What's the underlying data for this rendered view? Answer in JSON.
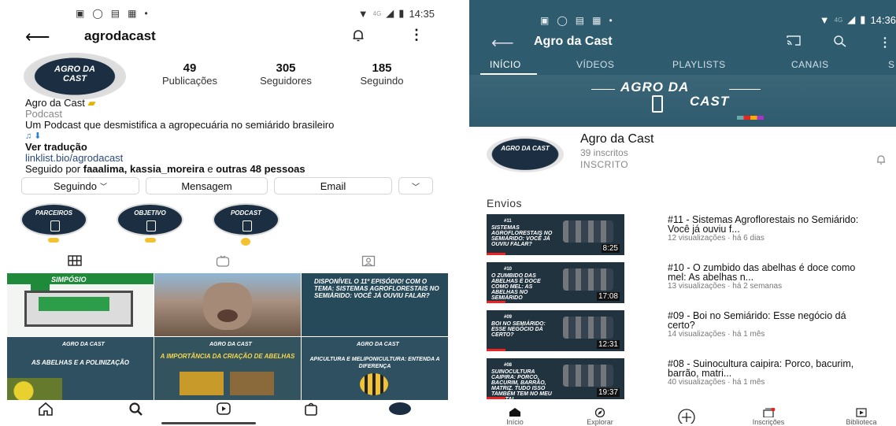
{
  "status_left": {
    "time": "14:35",
    "net": "4G"
  },
  "status_right": {
    "time": "14:36",
    "net": "4G"
  },
  "instagram": {
    "username": "agrodacast",
    "avatar_text": "AGRO DA CAST",
    "stats": [
      {
        "value": "49",
        "label": "Publicações"
      },
      {
        "value": "305",
        "label": "Seguidores"
      },
      {
        "value": "185",
        "label": "Seguindo"
      }
    ],
    "display_name": "Agro da Cast",
    "category": "Podcast",
    "bio": "Um Podcast que desmistifica a agropecuária no semiárido brasileiro",
    "translate": "Ver tradução",
    "link": "linklist.bio/agrodacast",
    "followed_by_prefix": "Seguido por",
    "followed_by_names": "faaalima, kassia_moreira",
    "followed_by_mid": "e",
    "followed_by_rest": "outras 48 pessoas",
    "buttons": {
      "following": "Seguindo",
      "message": "Mensagem",
      "email": "Email"
    },
    "highlights": [
      "PARCEIROS",
      "OBJETIVO",
      "PODCAST"
    ],
    "grid": [
      {
        "caption": "SIMPÓSIO"
      },
      {
        "caption": ""
      },
      {
        "caption": "DISPONÍVEL O 11º EPISÓDIO! COM O TEMA: SISTEMAS AGROFLORESTAIS NO SEMIÁRIDO: VOCÊ JÁ OUVIU FALAR?"
      },
      {
        "caption": "AS ABELHAS E A POLINIZAÇÃO"
      },
      {
        "caption": "A IMPORTÂNCIA DA CRIAÇÃO DE ABELHAS"
      },
      {
        "caption": "APICULTURA E MELIPONICULTURA: ENTENDA A DIFERENÇA"
      }
    ],
    "grid_logo": "AGRO DA CAST"
  },
  "youtube": {
    "title": "Agro da Cast",
    "tabs": [
      "INÍCIO",
      "VÍDEOS",
      "PLAYLISTS",
      "CANAIS",
      "S"
    ],
    "banner_line1": "AGRO DA",
    "banner_line2": "CAST",
    "channel_name": "Agro da Cast",
    "subscribers": "39 inscritos",
    "subscribed": "INSCRITO",
    "avatar_text": "AGRO DA CAST",
    "section": "Envios",
    "videos": [
      {
        "num": "#11",
        "thumb": "SISTEMAS AGROFLORESTAIS NO SEMIÁRIDO: VOCÊ JÁ OUVIU FALAR?",
        "duration": "8:25",
        "title": "#11 - Sistemas Agroflorestais no Semiárido: Você já ouviu f...",
        "meta": "12 visualizações · há 6 dias"
      },
      {
        "num": "#10",
        "thumb": "O ZUMBIDO DAS ABELHAS É DOCE COMO MEL: AS ABELHAS NO SEMIÁRIDO",
        "duration": "17:08",
        "title": "#10 - O zumbido das abelhas é doce como mel: As abelhas n...",
        "meta": "13 visualizações · há 2 semanas"
      },
      {
        "num": "#09",
        "thumb": "BOI NO SEMIÁRIDO: ESSE NEGÓCIO DÁ CERTO?",
        "duration": "12:31",
        "title": "#09 - Boi no Semiárido: Esse negócio dá certo?",
        "meta": "14 visualizações · há 1 mês"
      },
      {
        "num": "#08",
        "thumb": "SUINOCULTURA CAIPIRA: PORCO, BACURIM, BARRÃO, MATRIZ. TUDO ISSO TAMBÉM TEM NO MEU QUINTAL",
        "duration": "19:37",
        "title": "#08 - Suinocultura caipira: Porco, bacurim, barrão, matri...",
        "meta": "40 visualizações · há 1 mês"
      }
    ],
    "nav": [
      "Início",
      "Explorar",
      "",
      "Inscrições",
      "Biblioteca"
    ]
  },
  "colors": {
    "yt_header": "#2f5b6e",
    "brand_dark": "#1c2f42",
    "accent_red": "#e22222"
  }
}
